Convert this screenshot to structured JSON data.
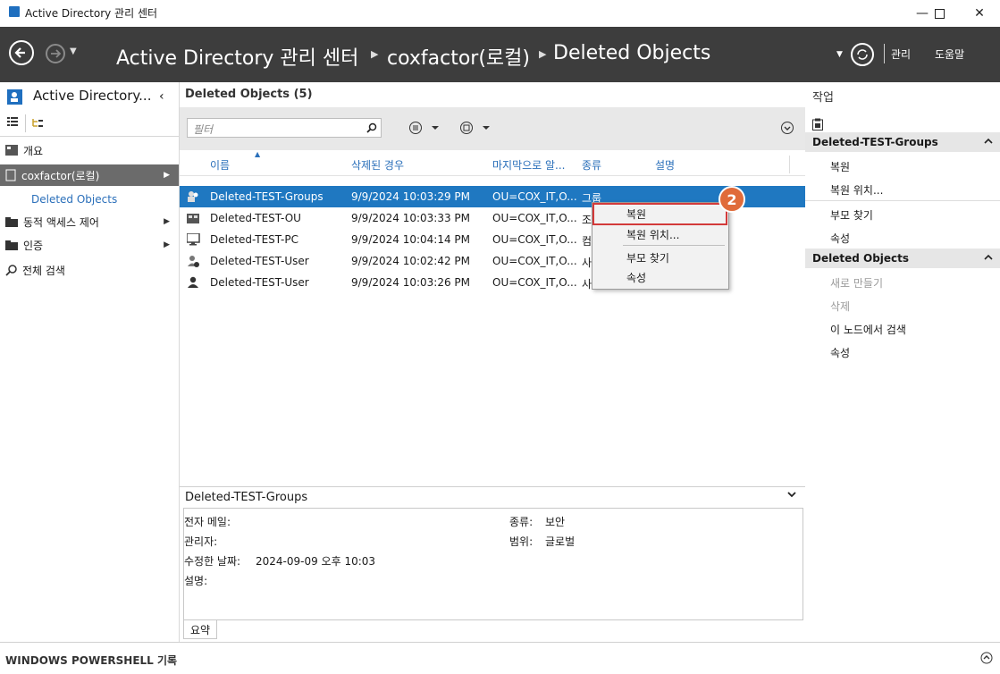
{
  "window": {
    "title": "Active Directory 관리 센터"
  },
  "nav": {
    "crumbs": [
      "Active Directory 관리 센터",
      "coxfactor(로컬)",
      "Deleted Objects"
    ],
    "manage": "관리",
    "help": "도움말"
  },
  "left": {
    "title": "Active Directory...",
    "items": [
      {
        "label": "개요"
      },
      {
        "label": "coxfactor(로컬)"
      },
      {
        "label": "Deleted Objects"
      },
      {
        "label": "동적 액세스 제어"
      },
      {
        "label": "인증"
      },
      {
        "label": "전체 검색"
      }
    ]
  },
  "center": {
    "heading": "Deleted Objects",
    "count": "(5)",
    "filter_placeholder": "필터",
    "columns": [
      "이름",
      "삭제된 경우",
      "마지막으로 알...",
      "종류",
      "설명"
    ],
    "rows": [
      {
        "name": "Deleted-TEST-Groups",
        "deleted": "9/9/2024 10:03:29 PM",
        "ou": "OU=COX_IT,O...",
        "type": "그룹",
        "icon": "group-icon"
      },
      {
        "name": "Deleted-TEST-OU",
        "deleted": "9/9/2024 10:03:33 PM",
        "ou": "OU=COX_IT,O...",
        "type": "조",
        "icon": "ou-icon"
      },
      {
        "name": "Deleted-TEST-PC",
        "deleted": "9/9/2024 10:04:14 PM",
        "ou": "OU=COX_IT,O...",
        "type": "컴",
        "icon": "computer-icon"
      },
      {
        "name": "Deleted-TEST-User",
        "deleted": "9/9/2024 10:02:42 PM",
        "ou": "OU=COX_IT,O...",
        "type": "사",
        "icon": "user-disabled-icon"
      },
      {
        "name": "Deleted-TEST-User",
        "deleted": "9/9/2024 10:03:26 PM",
        "ou": "OU=COX_IT,O...",
        "type": "사",
        "icon": "user-icon"
      }
    ],
    "context_menu": [
      "복원",
      "복원 위치...",
      "부모 찾기",
      "속성"
    ],
    "step_badge": "2",
    "detail": {
      "title": "Deleted-TEST-Groups",
      "email_label": "전자 메일:",
      "manager_label": "관리자:",
      "modified_label": "수정한 날짜:",
      "modified_value": "2024-09-09 오후 10:03",
      "desc_label": "설명:",
      "type_label": "종류:",
      "type_value": "보안",
      "scope_label": "범위:",
      "scope_value": "글로벌",
      "tab_summary": "요약"
    }
  },
  "right": {
    "title": "작업",
    "section1": "Deleted-TEST-Groups",
    "section1_items": [
      "복원",
      "복원 위치...",
      "부모 찾기",
      "속성"
    ],
    "section2": "Deleted Objects",
    "section2_items": [
      "새로 만들기",
      "삭제",
      "이 노드에서 검색",
      "속성"
    ]
  },
  "bottom": {
    "label": "WINDOWS POWERSHELL 기록"
  },
  "colors": {
    "accent": "#1f78c1",
    "nav_bg": "#3d3d3d",
    "highlight": "#d33a3a",
    "badge": "#e06b3a"
  }
}
